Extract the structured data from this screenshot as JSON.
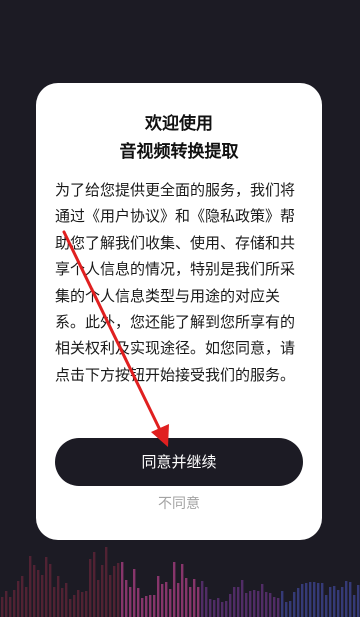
{
  "colors": {
    "background": "#1c1b24",
    "dialog_background": "#ffffff",
    "button_background": "#1c1b24",
    "button_text": "#ffffff",
    "secondary_text": "#a4a4a4",
    "annotation_arrow": "#e02020"
  },
  "dialog": {
    "title_line1": "欢迎使用",
    "title_line2": "音视频转换提取",
    "body": "为了给您提供更全面的服务，我们将通过《用户协议》和《隐私政策》帮助您了解我们收集、使用、存储和共享个人信息的情况，特别是我们所采集的个人信息类型与用途的对应关系。此外，您还能了解到您所享有的相关权利及实现途径。如您同意，请点击下方按钮开始接受我们的服务。",
    "agree_label": "同意并继续",
    "disagree_label": "不同意"
  }
}
